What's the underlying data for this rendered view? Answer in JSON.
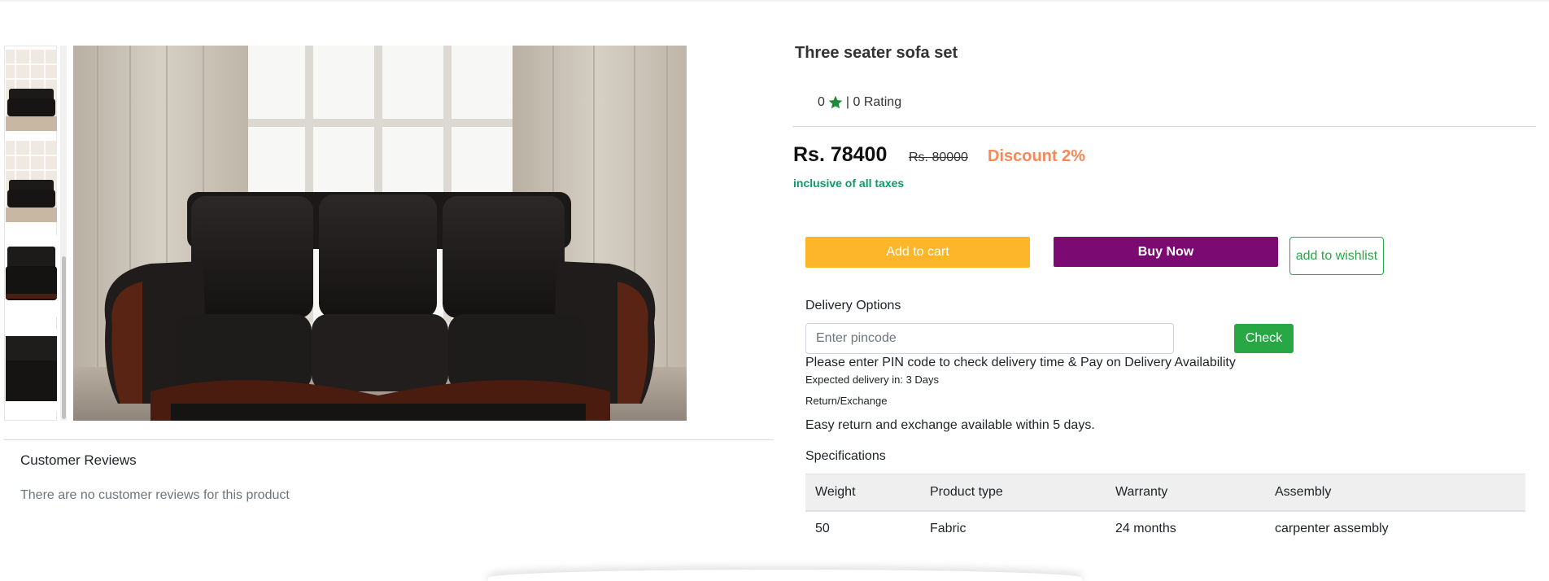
{
  "product": {
    "title": "Three seater sofa set",
    "rating_value": "0",
    "rating_suffix": "| 0 Rating",
    "price": "Rs. 78400",
    "mrp": "Rs. 80000",
    "discount": "Discount 2%",
    "taxes_note": "inclusive of all taxes"
  },
  "actions": {
    "add_to_cart": "Add to cart",
    "buy_now": "Buy Now",
    "wishlist": "add to wishlist"
  },
  "delivery": {
    "label": "Delivery Options",
    "pincode_placeholder": "Enter pincode",
    "check_label": "Check",
    "pin_note": "Please enter PIN code to check delivery time & Pay on Delivery Availability",
    "expected": "Expected delivery in: 3 Days",
    "return_label": "Return/Exchange",
    "return_text": "Easy return and exchange available within 5 days."
  },
  "specifications": {
    "label": "Specifications",
    "headers": [
      "Weight",
      "Product type",
      "Warranty",
      "Assembly"
    ],
    "rows": [
      [
        "50",
        "Fabric",
        "24 months",
        "carpenter assembly"
      ]
    ]
  },
  "reviews": {
    "title": "Customer Reviews",
    "empty_text": "There are no customer reviews for this product"
  },
  "colors": {
    "cart_button": "#fdb52a",
    "buy_button": "#7b0a72",
    "discount": "#f5895a",
    "taxes": "#0c9a6a",
    "star": "#1f8a3a",
    "check_button": "#28a745"
  },
  "icons": {
    "rating_star": "star-icon"
  }
}
